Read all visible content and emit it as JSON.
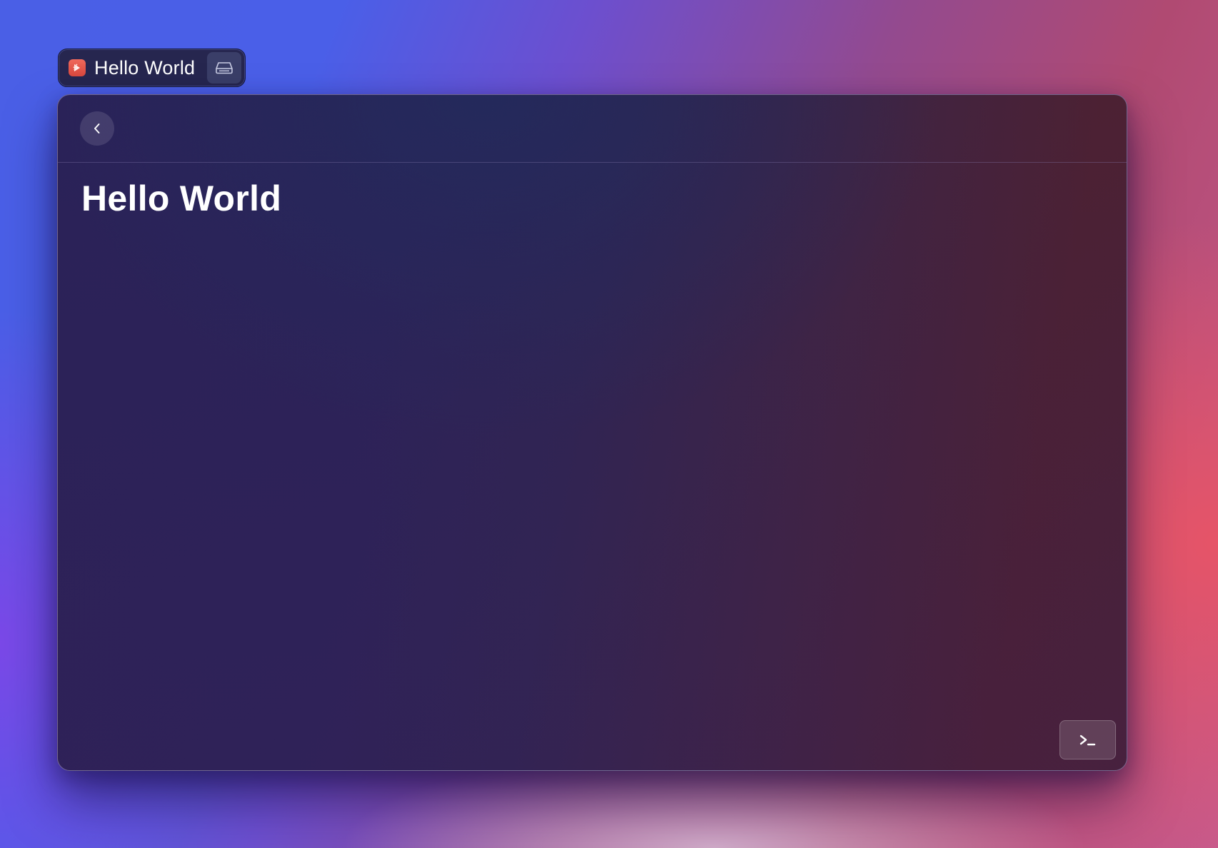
{
  "app_tab": {
    "title": "Hello World",
    "icon": "app-logo-icon",
    "action_icon": "drive-icon"
  },
  "toolbar": {
    "back_icon": "chevron-left-icon"
  },
  "main": {
    "heading": "Hello World"
  },
  "footer": {
    "terminal_icon": "terminal-icon"
  },
  "colors": {
    "app_icon": "#e45a4d",
    "window_bg_left": "#2a2258",
    "window_bg_right": "#4c2133",
    "text": "#ffffff"
  }
}
